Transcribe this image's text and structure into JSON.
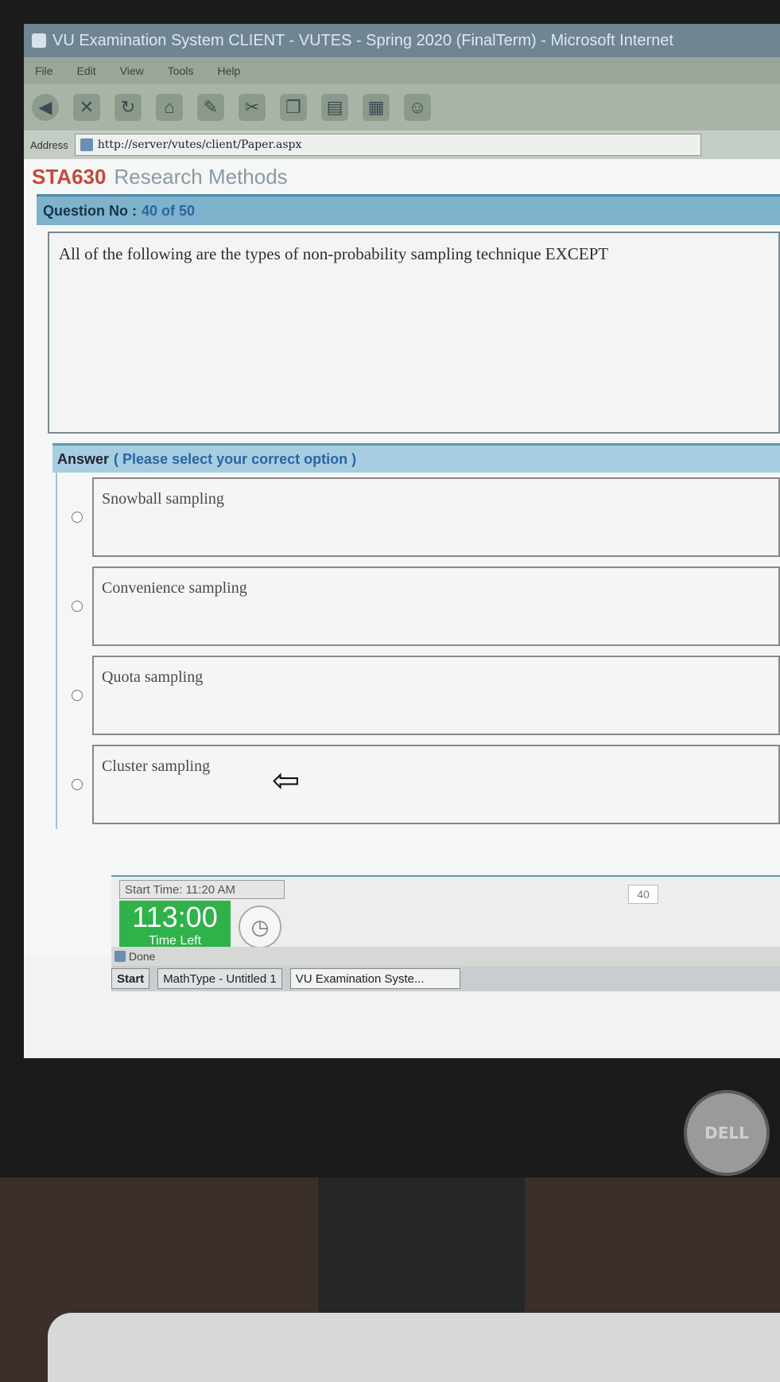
{
  "window": {
    "title": "VU Examination System CLIENT - VUTES - Spring 2020 (FinalTerm) - Microsoft Internet"
  },
  "menu": [
    "File",
    "Edit",
    "View",
    "Tools",
    "Help"
  ],
  "address": {
    "label": "Address",
    "url": "http://server/vutes/client/Paper.aspx"
  },
  "course": {
    "code": "STA630",
    "name": "Research Methods"
  },
  "question": {
    "label": "Question No :",
    "number": "40 of 50",
    "text": "All of the following are the types of non-probability sampling technique EXCEPT"
  },
  "answer": {
    "label": "Answer",
    "hint": "( Please select your correct option )",
    "options": [
      "Snowball sampling",
      "Convenience sampling",
      "Quota sampling",
      "Cluster sampling"
    ]
  },
  "pointer_arrow": "⇦",
  "footer": {
    "start_time": "Start Time: 11:20 AM",
    "time_left_value": "113:00",
    "time_left_label": "Time Left",
    "page_counter": "40"
  },
  "status": {
    "text": "Done"
  },
  "taskbar": {
    "start": "Start",
    "items": [
      "MathType - Untitled 1",
      "VU Examination Syste..."
    ]
  },
  "monitor_logo": "DELL"
}
